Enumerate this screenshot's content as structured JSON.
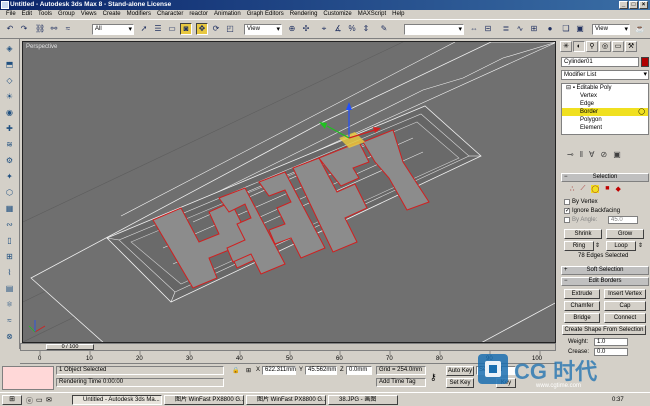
{
  "window": {
    "title": "Untitled - Autodesk 3ds Max 8 - Stand-alone License",
    "buttons": [
      "_",
      "□",
      "×"
    ]
  },
  "menu": [
    "File",
    "Edit",
    "Tools",
    "Group",
    "Views",
    "Create",
    "Modifiers",
    "Character",
    "reactor",
    "Animation",
    "Graph Editors",
    "Rendering",
    "Customize",
    "MAXScript",
    "Help"
  ],
  "toolbar": {
    "selection_filter": "All",
    "coord_system": "View",
    "named_sel": "",
    "render_view": "View"
  },
  "viewport": {
    "label": "Perspective",
    "axis": [
      "x",
      "y",
      "z"
    ]
  },
  "command_panel": {
    "object_name": "Cylinder01",
    "modifier_list": "Modifier List",
    "object_color": "#b00000",
    "stack": {
      "root": "Editable Poly",
      "items": [
        "Vertex",
        "Edge",
        "Border",
        "Polygon",
        "Element"
      ],
      "selected": "Border"
    },
    "selection": {
      "header": "Selection",
      "by_vertex": "By Vertex",
      "ignore_backfacing": "Ignore Backfacing",
      "by_angle": "By Angle:",
      "angle_value": "45.0",
      "shrink": "Shrink",
      "grow": "Grow",
      "ring": "Ring",
      "loop": "Loop",
      "status": "78 Edges Selected"
    },
    "soft_selection": "Soft Selection",
    "edit_borders": {
      "header": "Edit Borders",
      "extrude": "Extrude",
      "insert_vertex": "Insert Vertex",
      "chamfer": "Chamfer",
      "cap": "Cap",
      "bridge": "Bridge",
      "connect": "Connect",
      "create_shape": "Create Shape From Selection",
      "weight_label": "Weight:",
      "weight_value": "1.0",
      "crease_label": "Crease:",
      "crease_value": "0.0"
    }
  },
  "timeline": {
    "slider_label": "0 / 100",
    "ticks": [
      "0",
      "10",
      "20",
      "30",
      "40",
      "50",
      "60",
      "70",
      "80",
      "90",
      "100"
    ]
  },
  "status": {
    "selected": "1 Object Selected",
    "prompt": "Rendering Time  0:00:00",
    "x_label": "X",
    "x_value": "622.311mm",
    "y_label": "Y",
    "y_value": "45.562mm",
    "z_label": "Z",
    "z_value": "0.0mm",
    "grid": "Grid = 254.0mm",
    "add_time_tag": "Add Time Tag",
    "auto_key": "Auto Key",
    "set_key": "Set Key",
    "key_filter": "Selected",
    "key_filters": "Key Filters..."
  },
  "taskbar": {
    "tasks": [
      "Untitled - Autodesk 3ds Ma...",
      "图片 WinFast PX8800 G...",
      "图片 WinFast PX8800 G...",
      "38.JPG - 画图"
    ],
    "clock": "0:37"
  },
  "watermark": {
    "brand": "CG 时代",
    "url": "www.cgtime.com"
  },
  "colors": {
    "title_start": "#0a246a",
    "title_end": "#3a6ea5",
    "selected_stack": "#f0e020",
    "edge_selection": "#d02020",
    "viewport_bg": "#6f6f6f"
  }
}
